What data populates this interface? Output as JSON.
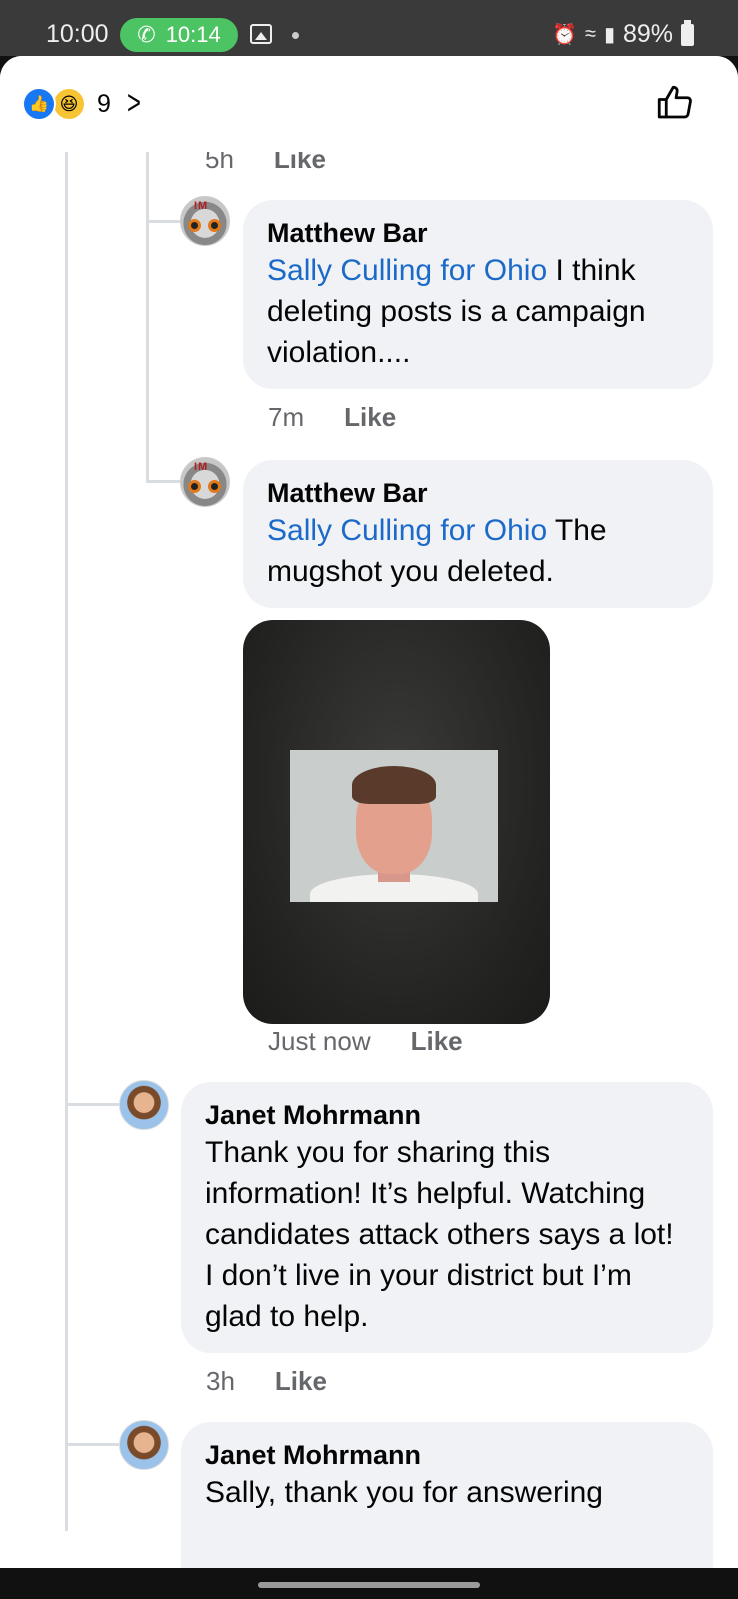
{
  "status_bar": {
    "time": "10:00",
    "call_time": "10:14",
    "battery": "89%"
  },
  "reactions": {
    "count": "9",
    "icons": [
      "like-icon",
      "haha-icon"
    ]
  },
  "thread": {
    "partial_meta": {
      "time": "5h",
      "like": "Like"
    },
    "comments": [
      {
        "author": "Matthew Bar",
        "mention": "Sally Culling for Ohio",
        "text": " I think deleting posts is a campaign violation....",
        "time": "7m",
        "like": "Like"
      },
      {
        "author": "Matthew Bar",
        "mention": "Sally Culling for Ohio",
        "text": " The mugshot you deleted.",
        "time": "Just now",
        "like": "Like"
      },
      {
        "author": "Janet Mohrmann",
        "text": "Thank you for sharing this information! It’s helpful. Watching candidates attack others says a lot! I don’t live in your district but I’m glad to help.",
        "time": "3h",
        "like": "Like"
      },
      {
        "author": "Janet Mohrmann",
        "text": "Sally, thank you for answering"
      }
    ]
  },
  "colors": {
    "mention": "#1b6ac9",
    "bubble": "#f0f2f5",
    "like_blue": "#1877f2"
  }
}
